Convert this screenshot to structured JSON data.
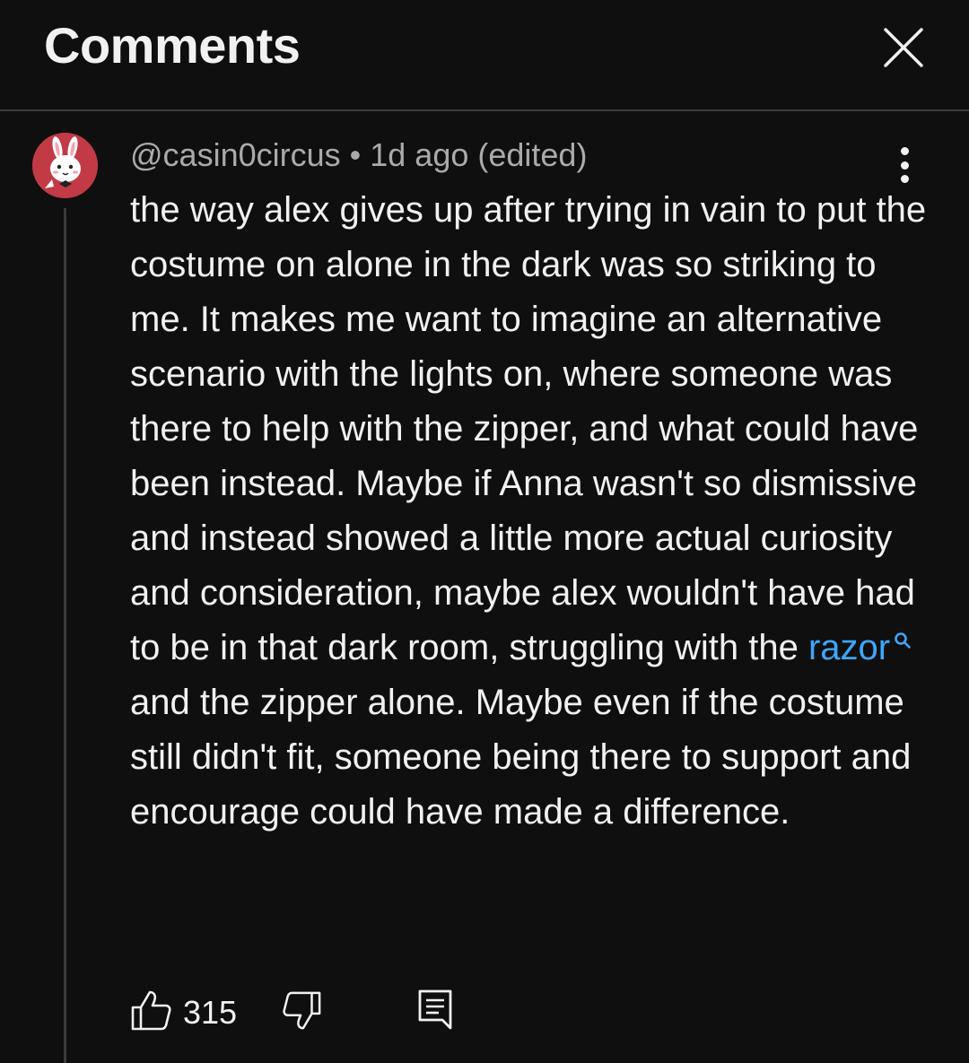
{
  "header": {
    "title": "Comments",
    "close_icon": "close-icon"
  },
  "comment": {
    "avatar_icon": "bunny-avatar",
    "author": "@casin0circus",
    "separator": "•",
    "time": "1d ago (edited)",
    "more_icon": "more-vert-icon",
    "text_part1": "the way alex gives up after trying in vain to put the costume on alone in the dark was so striking to me. It makes me want to imagine an alternative scenario with the lights on, where someone was there to help with the zipper, and what could have been instead. Maybe if Anna wasn't so dismissive and instead showed a little more actual curiosity and consideration, maybe alex wouldn't have had to be in that dark room, struggling with the ",
    "search_link": "razor",
    "text_part2": "and the zipper alone. Maybe even if the costume still didn't fit, someone being there to support and encourage could have made a difference.",
    "like_icon": "thumbs-up-icon",
    "like_count": "315",
    "dislike_icon": "thumbs-down-icon",
    "reply_icon": "reply-icon"
  },
  "colors": {
    "background": "#0f0f0f",
    "text": "#f1f1f1",
    "secondary_text": "#aaaaaa",
    "link": "#3ea6ff",
    "avatar_bg": "#c23a45"
  }
}
